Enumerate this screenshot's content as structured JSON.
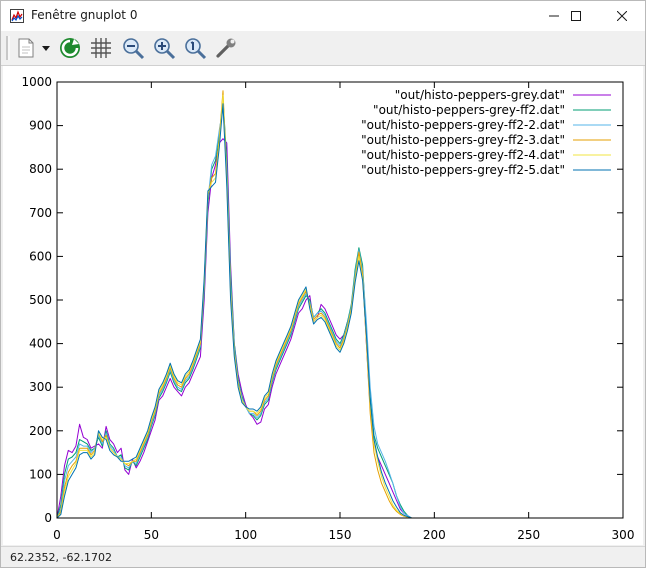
{
  "window": {
    "title": "Fenêtre gnuplot 0",
    "minimize_icon": "minimize-icon",
    "maximize_icon": "maximize-icon",
    "close_icon": "close-icon"
  },
  "toolbar": {
    "buttons": [
      "copy-icon",
      "dropdown-arrow-icon",
      "replot-icon",
      "grid-icon",
      "zoom-out-icon",
      "zoom-in-icon",
      "zoom-reset-icon",
      "options-wrench-icon"
    ]
  },
  "status": {
    "coords": "62.2352, -62.1702"
  },
  "colors": {
    "series1": "#9400d3",
    "series2": "#009e73",
    "series3": "#56b4e9",
    "series4": "#e69f00",
    "series5": "#f0e442",
    "series6": "#0072b2"
  },
  "chart_data": {
    "type": "line",
    "title": "",
    "xlabel": "",
    "ylabel": "",
    "xlim": [
      0,
      300
    ],
    "ylim": [
      0,
      1000
    ],
    "xticks": [
      0,
      50,
      100,
      150,
      200,
      250,
      300
    ],
    "yticks": [
      0,
      100,
      200,
      300,
      400,
      500,
      600,
      700,
      800,
      900,
      1000
    ],
    "grid": false,
    "legend_position": "top-right",
    "x_step": 2,
    "x_start": 0,
    "series": [
      {
        "name": "\"out/histo-peppers-grey.dat\"",
        "color": "#9400d3",
        "values": [
          0,
          50,
          120,
          155,
          150,
          165,
          215,
          185,
          180,
          160,
          165,
          170,
          160,
          210,
          180,
          170,
          150,
          160,
          110,
          100,
          135,
          115,
          130,
          150,
          175,
          200,
          225,
          270,
          280,
          300,
          320,
          300,
          290,
          280,
          300,
          310,
          330,
          350,
          370,
          500,
          700,
          780,
          810,
          860,
          870,
          860,
          580,
          400,
          330,
          290,
          260,
          240,
          230,
          215,
          220,
          250,
          260,
          300,
          330,
          350,
          370,
          390,
          410,
          440,
          470,
          480,
          500,
          510,
          450,
          460,
          490,
          480,
          460,
          440,
          420,
          410,
          420,
          450,
          480,
          560,
          600,
          560,
          400,
          250,
          170,
          140,
          120,
          100,
          80,
          60,
          40,
          20,
          10,
          5,
          0,
          0,
          0,
          0,
          0,
          0,
          0,
          0,
          0,
          0,
          0,
          0,
          0,
          0,
          0,
          0,
          0,
          0,
          0,
          0,
          0,
          0,
          0,
          0,
          0,
          0,
          0,
          0,
          0,
          0,
          0,
          0,
          0,
          0,
          0,
          0,
          0
        ]
      },
      {
        "name": "\"out/histo-peppers-grey-ff2.dat\"",
        "color": "#009e73",
        "values": [
          0,
          30,
          100,
          135,
          140,
          150,
          180,
          175,
          170,
          155,
          160,
          185,
          165,
          200,
          170,
          160,
          140,
          145,
          115,
          110,
          130,
          120,
          140,
          160,
          180,
          210,
          235,
          275,
          290,
          310,
          335,
          310,
          295,
          290,
          310,
          320,
          340,
          365,
          390,
          520,
          720,
          800,
          820,
          880,
          960,
          820,
          560,
          400,
          320,
          280,
          255,
          240,
          235,
          225,
          235,
          260,
          270,
          310,
          340,
          360,
          380,
          400,
          420,
          450,
          480,
          495,
          510,
          500,
          460,
          470,
          480,
          470,
          450,
          430,
          410,
          400,
          420,
          450,
          490,
          570,
          620,
          580,
          430,
          280,
          190,
          160,
          140,
          120,
          100,
          80,
          50,
          30,
          15,
          5,
          0,
          0,
          0,
          0,
          0,
          0,
          0,
          0,
          0,
          0,
          0,
          0,
          0,
          0,
          0,
          0,
          0,
          0,
          0,
          0,
          0,
          0,
          0,
          0,
          0,
          0,
          0,
          0,
          0,
          0,
          0,
          0,
          0,
          0,
          0,
          0,
          0
        ]
      },
      {
        "name": "\"out/histo-peppers-grey-ff2-2.dat\"",
        "color": "#56b4e9",
        "values": [
          0,
          20,
          85,
          120,
          130,
          140,
          170,
          165,
          165,
          150,
          160,
          190,
          170,
          195,
          165,
          155,
          140,
          140,
          120,
          115,
          130,
          125,
          145,
          165,
          185,
          215,
          240,
          280,
          295,
          315,
          340,
          315,
          300,
          295,
          315,
          325,
          345,
          370,
          395,
          530,
          730,
          810,
          830,
          890,
          940,
          800,
          540,
          390,
          315,
          275,
          255,
          240,
          240,
          230,
          240,
          265,
          275,
          315,
          345,
          365,
          385,
          405,
          425,
          455,
          485,
          500,
          515,
          495,
          460,
          470,
          475,
          465,
          445,
          425,
          405,
          395,
          415,
          445,
          485,
          560,
          615,
          570,
          450,
          300,
          210,
          170,
          150,
          130,
          105,
          80,
          50,
          25,
          10,
          5,
          0,
          0,
          0,
          0,
          0,
          0,
          0,
          0,
          0,
          0,
          0,
          0,
          0,
          0,
          0,
          0,
          0,
          0,
          0,
          0,
          0,
          0,
          0,
          0,
          0,
          0,
          0,
          0,
          0,
          0,
          0,
          0,
          0,
          0,
          0,
          0,
          0
        ]
      },
      {
        "name": "\"out/histo-peppers-grey-ff2-3.dat\"",
        "color": "#e69f00",
        "values": [
          0,
          15,
          70,
          105,
          120,
          130,
          160,
          160,
          160,
          145,
          155,
          195,
          175,
          190,
          160,
          150,
          140,
          135,
          125,
          120,
          130,
          130,
          150,
          170,
          190,
          220,
          245,
          285,
          300,
          320,
          345,
          320,
          305,
          300,
          320,
          330,
          350,
          375,
          400,
          540,
          740,
          780,
          790,
          870,
          980,
          780,
          520,
          380,
          310,
          270,
          255,
          245,
          245,
          235,
          245,
          270,
          280,
          320,
          350,
          370,
          390,
          410,
          430,
          460,
          490,
          505,
          520,
          490,
          455,
          465,
          470,
          460,
          440,
          420,
          400,
          390,
          410,
          440,
          480,
          550,
          610,
          560,
          400,
          240,
          150,
          110,
          80,
          60,
          40,
          25,
          15,
          8,
          4,
          2,
          0,
          0,
          0,
          0,
          0,
          0,
          0,
          0,
          0,
          0,
          0,
          0,
          0,
          0,
          0,
          0,
          0,
          0,
          0,
          0,
          0,
          0,
          0,
          0,
          0,
          0,
          0,
          0,
          0,
          0,
          0,
          0,
          0,
          0,
          0,
          0,
          0
        ]
      },
      {
        "name": "\"out/histo-peppers-grey-ff2-4.dat\"",
        "color": "#f0e442",
        "values": [
          0,
          10,
          60,
          95,
          110,
          125,
          155,
          155,
          155,
          140,
          150,
          195,
          180,
          185,
          160,
          150,
          140,
          135,
          125,
          125,
          130,
          135,
          155,
          175,
          195,
          225,
          250,
          290,
          305,
          325,
          350,
          325,
          310,
          305,
          325,
          335,
          355,
          380,
          405,
          545,
          745,
          770,
          780,
          860,
          970,
          770,
          510,
          375,
          305,
          270,
          255,
          245,
          245,
          240,
          250,
          275,
          285,
          325,
          355,
          375,
          395,
          415,
          435,
          465,
          495,
          510,
          525,
          485,
          450,
          460,
          465,
          455,
          435,
          415,
          395,
          385,
          405,
          435,
          475,
          545,
          600,
          550,
          410,
          260,
          170,
          130,
          95,
          70,
          50,
          30,
          18,
          10,
          5,
          2,
          0,
          0,
          0,
          0,
          0,
          0,
          0,
          0,
          0,
          0,
          0,
          0,
          0,
          0,
          0,
          0,
          0,
          0,
          0,
          0,
          0,
          0,
          0,
          0,
          0,
          0,
          0,
          0,
          0,
          0,
          0,
          0,
          0,
          0,
          0,
          0,
          0
        ]
      },
      {
        "name": "\"out/histo-peppers-grey-ff2-5.dat\"",
        "color": "#0072b2",
        "values": [
          0,
          8,
          50,
          85,
          100,
          115,
          145,
          150,
          150,
          135,
          145,
          200,
          185,
          180,
          155,
          145,
          140,
          130,
          130,
          130,
          135,
          140,
          160,
          180,
          200,
          230,
          255,
          295,
          310,
          330,
          355,
          330,
          315,
          310,
          330,
          340,
          360,
          385,
          410,
          550,
          750,
          760,
          770,
          850,
          950,
          760,
          500,
          370,
          300,
          265,
          255,
          250,
          250,
          245,
          255,
          280,
          290,
          330,
          360,
          380,
          400,
          420,
          440,
          470,
          500,
          515,
          530,
          480,
          445,
          455,
          460,
          450,
          430,
          410,
          390,
          380,
          400,
          430,
          470,
          540,
          590,
          545,
          420,
          270,
          180,
          140,
          105,
          80,
          60,
          40,
          25,
          12,
          6,
          3,
          0,
          0,
          0,
          0,
          0,
          0,
          0,
          0,
          0,
          0,
          0,
          0,
          0,
          0,
          0,
          0,
          0,
          0,
          0,
          0,
          0,
          0,
          0,
          0,
          0,
          0,
          0,
          0,
          0,
          0,
          0,
          0,
          0,
          0,
          0,
          0,
          0
        ]
      }
    ]
  }
}
